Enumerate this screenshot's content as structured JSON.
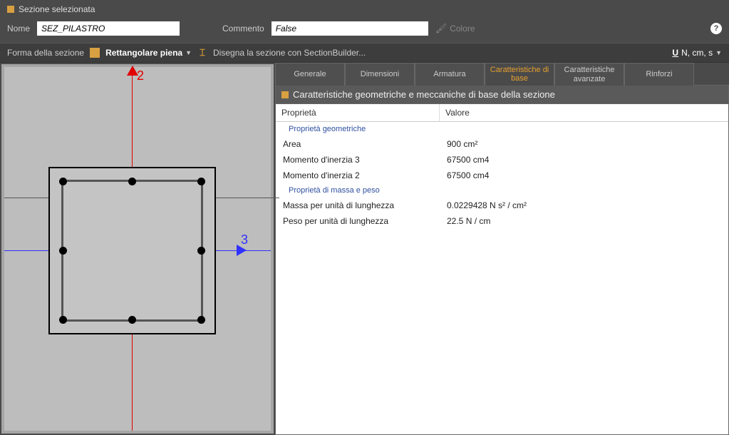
{
  "window": {
    "title": "Sezione selezionata"
  },
  "form": {
    "name_label": "Nome",
    "name_value": "SEZ_PILASTRO",
    "comment_label": "Commento",
    "comment_value": "False",
    "color_label": "Colore"
  },
  "toolbar": {
    "shape_label": "Forma della sezione",
    "shape_value": "Rettangolare piena",
    "sectionbuilder": "Disegna la sezione con SectionBuilder...",
    "units": "N, cm, s"
  },
  "viewport": {
    "axis_v": "2",
    "axis_h": "3"
  },
  "tabs": [
    {
      "label": "Generale"
    },
    {
      "label": "Dimensioni"
    },
    {
      "label": "Armatura"
    },
    {
      "label": "Caratteristiche di base"
    },
    {
      "label": "Caratteristiche avanzate"
    },
    {
      "label": "Rinforzi"
    }
  ],
  "panel": {
    "title": "Caratteristiche geometriche e meccaniche di base della sezione",
    "col_property": "Proprietà",
    "col_value": "Valore",
    "groups": [
      {
        "title": "Proprietà geometriche",
        "rows": [
          {
            "name": "Area",
            "value": "900 cm²"
          },
          {
            "name": "Momento d'inerzia 3",
            "value": "67500 cm4"
          },
          {
            "name": "Momento d'inerzia 2",
            "value": "67500 cm4"
          }
        ]
      },
      {
        "title": "Proprietà di massa e peso",
        "rows": [
          {
            "name": "Massa per unità di lunghezza",
            "value": "0.0229428 N s² / cm²"
          },
          {
            "name": "Peso per unità di lunghezza",
            "value": "22.5 N / cm"
          }
        ]
      }
    ]
  }
}
